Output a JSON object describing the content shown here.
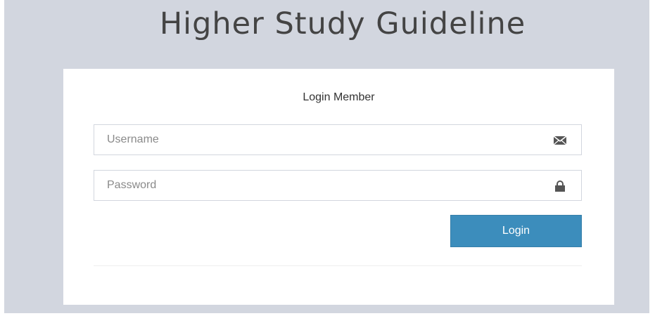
{
  "header": {
    "title": "Higher Study Guideline"
  },
  "login": {
    "heading": "Login Member",
    "username": {
      "placeholder": "Username",
      "value": "",
      "icon": "envelope-icon"
    },
    "password": {
      "placeholder": "Password",
      "value": "",
      "icon": "lock-icon"
    },
    "submit_label": "Login"
  },
  "colors": {
    "page_background": "#d2d6df",
    "box_background": "#ffffff",
    "button_primary": "#3c8dbc",
    "icon": "#555555"
  }
}
